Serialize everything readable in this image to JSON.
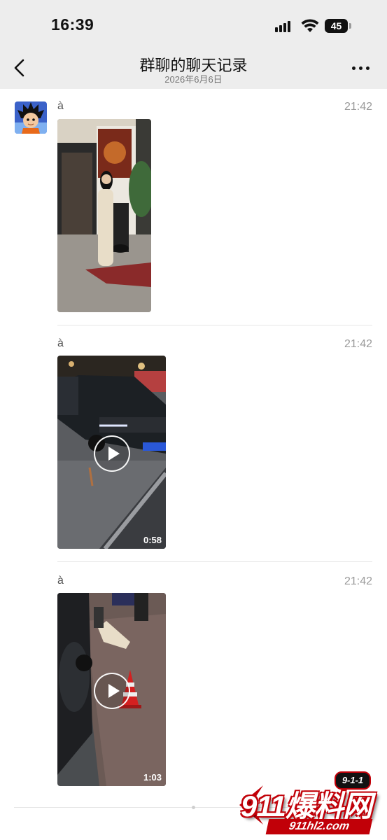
{
  "status_bar": {
    "time": "16:39",
    "battery": "45"
  },
  "header": {
    "title": "群聊的聊天记录",
    "subtitle": "2026年6月6日"
  },
  "messages": [
    {
      "sender": "à",
      "time": "21:42",
      "type": "image"
    },
    {
      "sender": "à",
      "time": "21:42",
      "type": "video",
      "duration": "0:58"
    },
    {
      "sender": "à",
      "time": "21:42",
      "type": "video",
      "duration": "1:03"
    }
  ],
  "watermark": {
    "brand": "911爆料网",
    "badge": "9-1-1",
    "url": "911hl2.com"
  },
  "colors": {
    "header_bg": "#ededed",
    "time_gray": "#9a9a9a",
    "watermark_red": "#c10008"
  }
}
